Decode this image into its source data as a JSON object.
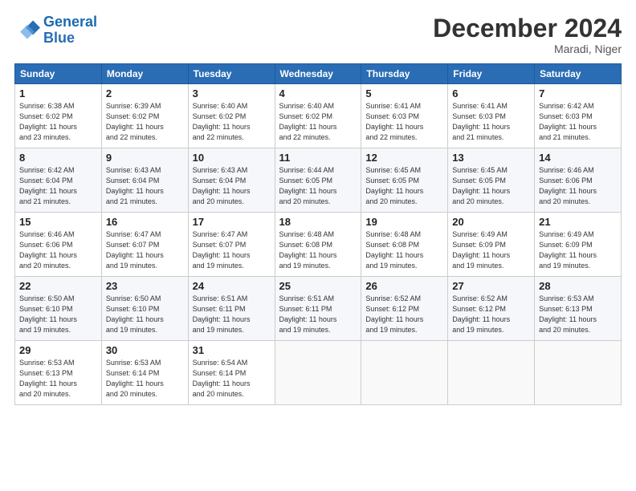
{
  "logo": {
    "line1": "General",
    "line2": "Blue"
  },
  "title": "December 2024",
  "location": "Maradi, Niger",
  "headers": [
    "Sunday",
    "Monday",
    "Tuesday",
    "Wednesday",
    "Thursday",
    "Friday",
    "Saturday"
  ],
  "weeks": [
    [
      {
        "day": "1",
        "info": "Sunrise: 6:38 AM\nSunset: 6:02 PM\nDaylight: 11 hours\nand 23 minutes."
      },
      {
        "day": "2",
        "info": "Sunrise: 6:39 AM\nSunset: 6:02 PM\nDaylight: 11 hours\nand 22 minutes."
      },
      {
        "day": "3",
        "info": "Sunrise: 6:40 AM\nSunset: 6:02 PM\nDaylight: 11 hours\nand 22 minutes."
      },
      {
        "day": "4",
        "info": "Sunrise: 6:40 AM\nSunset: 6:02 PM\nDaylight: 11 hours\nand 22 minutes."
      },
      {
        "day": "5",
        "info": "Sunrise: 6:41 AM\nSunset: 6:03 PM\nDaylight: 11 hours\nand 22 minutes."
      },
      {
        "day": "6",
        "info": "Sunrise: 6:41 AM\nSunset: 6:03 PM\nDaylight: 11 hours\nand 21 minutes."
      },
      {
        "day": "7",
        "info": "Sunrise: 6:42 AM\nSunset: 6:03 PM\nDaylight: 11 hours\nand 21 minutes."
      }
    ],
    [
      {
        "day": "8",
        "info": "Sunrise: 6:42 AM\nSunset: 6:04 PM\nDaylight: 11 hours\nand 21 minutes."
      },
      {
        "day": "9",
        "info": "Sunrise: 6:43 AM\nSunset: 6:04 PM\nDaylight: 11 hours\nand 21 minutes."
      },
      {
        "day": "10",
        "info": "Sunrise: 6:43 AM\nSunset: 6:04 PM\nDaylight: 11 hours\nand 20 minutes."
      },
      {
        "day": "11",
        "info": "Sunrise: 6:44 AM\nSunset: 6:05 PM\nDaylight: 11 hours\nand 20 minutes."
      },
      {
        "day": "12",
        "info": "Sunrise: 6:45 AM\nSunset: 6:05 PM\nDaylight: 11 hours\nand 20 minutes."
      },
      {
        "day": "13",
        "info": "Sunrise: 6:45 AM\nSunset: 6:05 PM\nDaylight: 11 hours\nand 20 minutes."
      },
      {
        "day": "14",
        "info": "Sunrise: 6:46 AM\nSunset: 6:06 PM\nDaylight: 11 hours\nand 20 minutes."
      }
    ],
    [
      {
        "day": "15",
        "info": "Sunrise: 6:46 AM\nSunset: 6:06 PM\nDaylight: 11 hours\nand 20 minutes."
      },
      {
        "day": "16",
        "info": "Sunrise: 6:47 AM\nSunset: 6:07 PM\nDaylight: 11 hours\nand 19 minutes."
      },
      {
        "day": "17",
        "info": "Sunrise: 6:47 AM\nSunset: 6:07 PM\nDaylight: 11 hours\nand 19 minutes."
      },
      {
        "day": "18",
        "info": "Sunrise: 6:48 AM\nSunset: 6:08 PM\nDaylight: 11 hours\nand 19 minutes."
      },
      {
        "day": "19",
        "info": "Sunrise: 6:48 AM\nSunset: 6:08 PM\nDaylight: 11 hours\nand 19 minutes."
      },
      {
        "day": "20",
        "info": "Sunrise: 6:49 AM\nSunset: 6:09 PM\nDaylight: 11 hours\nand 19 minutes."
      },
      {
        "day": "21",
        "info": "Sunrise: 6:49 AM\nSunset: 6:09 PM\nDaylight: 11 hours\nand 19 minutes."
      }
    ],
    [
      {
        "day": "22",
        "info": "Sunrise: 6:50 AM\nSunset: 6:10 PM\nDaylight: 11 hours\nand 19 minutes."
      },
      {
        "day": "23",
        "info": "Sunrise: 6:50 AM\nSunset: 6:10 PM\nDaylight: 11 hours\nand 19 minutes."
      },
      {
        "day": "24",
        "info": "Sunrise: 6:51 AM\nSunset: 6:11 PM\nDaylight: 11 hours\nand 19 minutes."
      },
      {
        "day": "25",
        "info": "Sunrise: 6:51 AM\nSunset: 6:11 PM\nDaylight: 11 hours\nand 19 minutes."
      },
      {
        "day": "26",
        "info": "Sunrise: 6:52 AM\nSunset: 6:12 PM\nDaylight: 11 hours\nand 19 minutes."
      },
      {
        "day": "27",
        "info": "Sunrise: 6:52 AM\nSunset: 6:12 PM\nDaylight: 11 hours\nand 19 minutes."
      },
      {
        "day": "28",
        "info": "Sunrise: 6:53 AM\nSunset: 6:13 PM\nDaylight: 11 hours\nand 20 minutes."
      }
    ],
    [
      {
        "day": "29",
        "info": "Sunrise: 6:53 AM\nSunset: 6:13 PM\nDaylight: 11 hours\nand 20 minutes."
      },
      {
        "day": "30",
        "info": "Sunrise: 6:53 AM\nSunset: 6:14 PM\nDaylight: 11 hours\nand 20 minutes."
      },
      {
        "day": "31",
        "info": "Sunrise: 6:54 AM\nSunset: 6:14 PM\nDaylight: 11 hours\nand 20 minutes."
      },
      {
        "day": "",
        "info": ""
      },
      {
        "day": "",
        "info": ""
      },
      {
        "day": "",
        "info": ""
      },
      {
        "day": "",
        "info": ""
      }
    ]
  ]
}
